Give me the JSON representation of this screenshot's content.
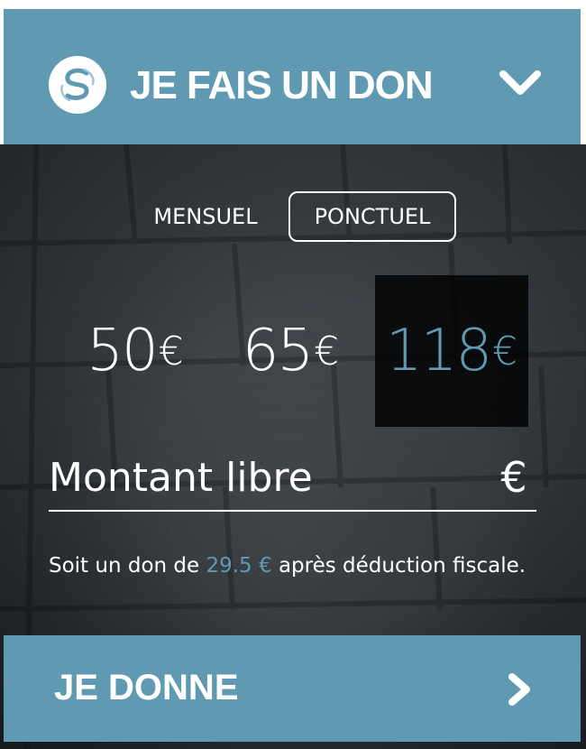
{
  "header": {
    "title": "JE FAIS UN DON",
    "logo_icon": "s-logo-icon",
    "toggle_icon": "chevron-down-icon"
  },
  "frequency": {
    "options": [
      "MENSUEL",
      "PONCTUEL"
    ],
    "selected": "PONCTUEL"
  },
  "amounts": [
    {
      "value": "50",
      "currency": "€"
    },
    {
      "value": "65",
      "currency": "€"
    },
    {
      "value": "118",
      "currency": "€"
    }
  ],
  "selected_amount": "118",
  "custom_amount": {
    "placeholder": "Montant libre",
    "value": "",
    "currency": "€"
  },
  "tax_note": {
    "prefix": "Soit un don de",
    "amount": "29.5 €",
    "suffix": "après déduction fiscale."
  },
  "submit": {
    "label": "JE DONNE",
    "icon": "chevron-right-icon"
  },
  "colors": {
    "accent": "#5f9ab2",
    "text": "#ffffff",
    "selected_bg": "#0d0d0d"
  }
}
